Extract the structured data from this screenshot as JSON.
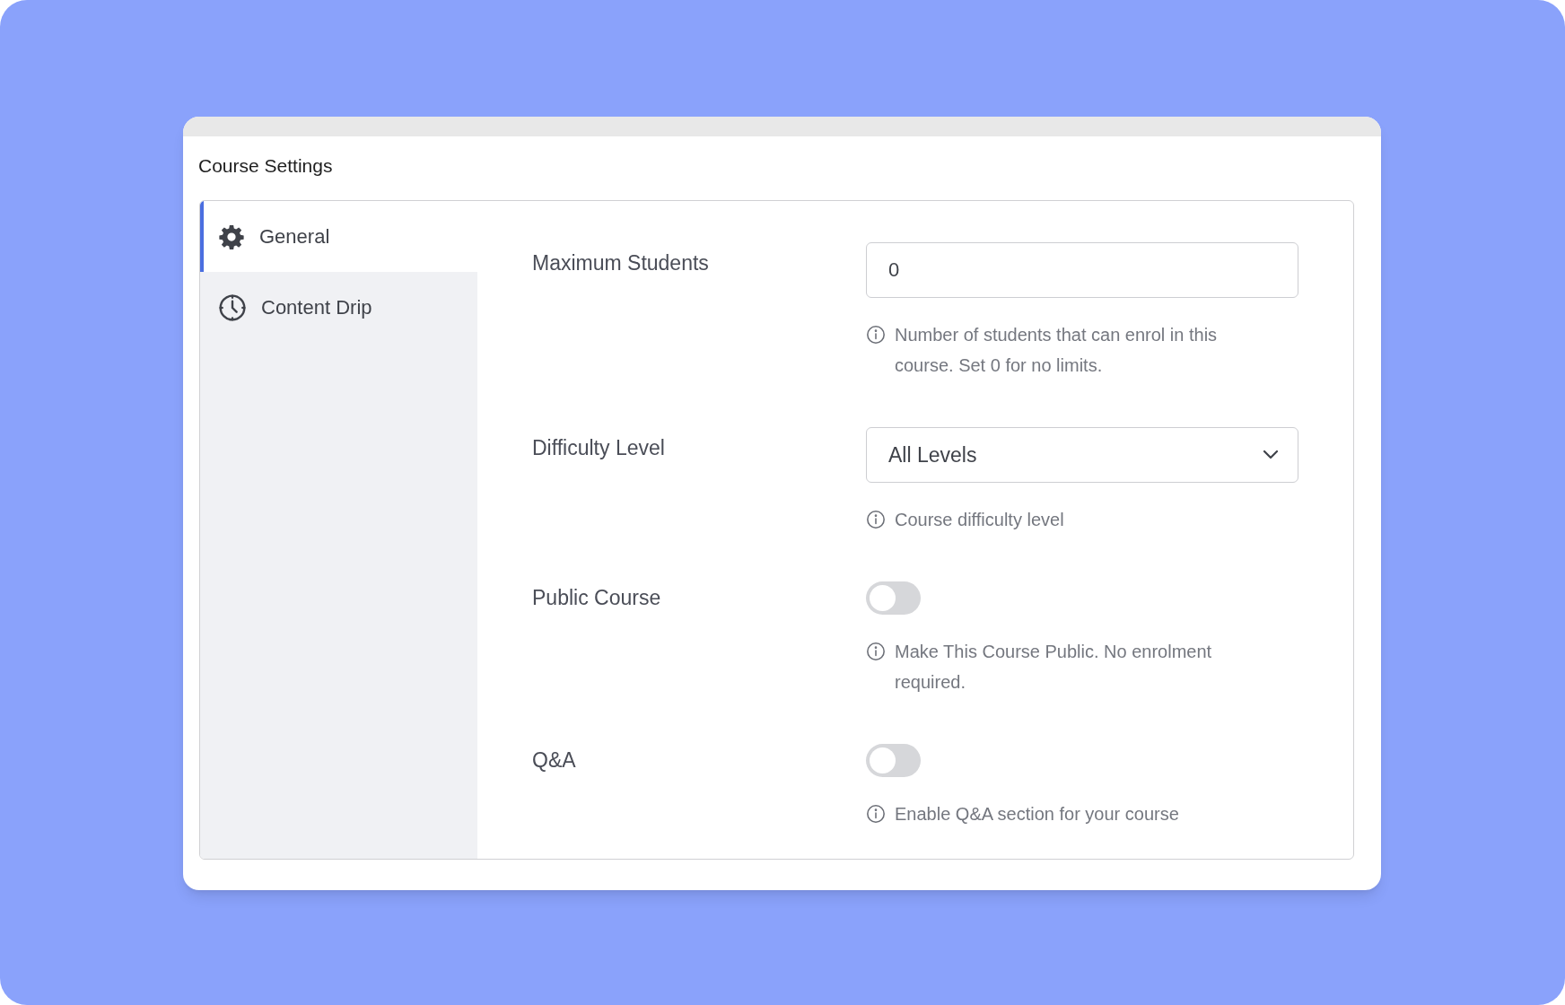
{
  "window": {
    "title": "Course Settings"
  },
  "sidebar": {
    "items": [
      {
        "label": "General",
        "selected": true
      },
      {
        "label": "Content Drip",
        "selected": false
      }
    ]
  },
  "settings": [
    {
      "kind": "number",
      "label": "Maximum Students",
      "value": "0",
      "help": "Number of students that can enrol in this course. Set 0 for no limits."
    },
    {
      "kind": "select",
      "label": "Difficulty Level",
      "value": "All Levels",
      "help": "Course difficulty level"
    },
    {
      "kind": "toggle",
      "label": "Public Course",
      "on": false,
      "help": "Make This Course Public. No enrolment required."
    },
    {
      "kind": "toggle",
      "label": "Q&A",
      "on": false,
      "help": "Enable Q&A section for your course"
    }
  ]
}
